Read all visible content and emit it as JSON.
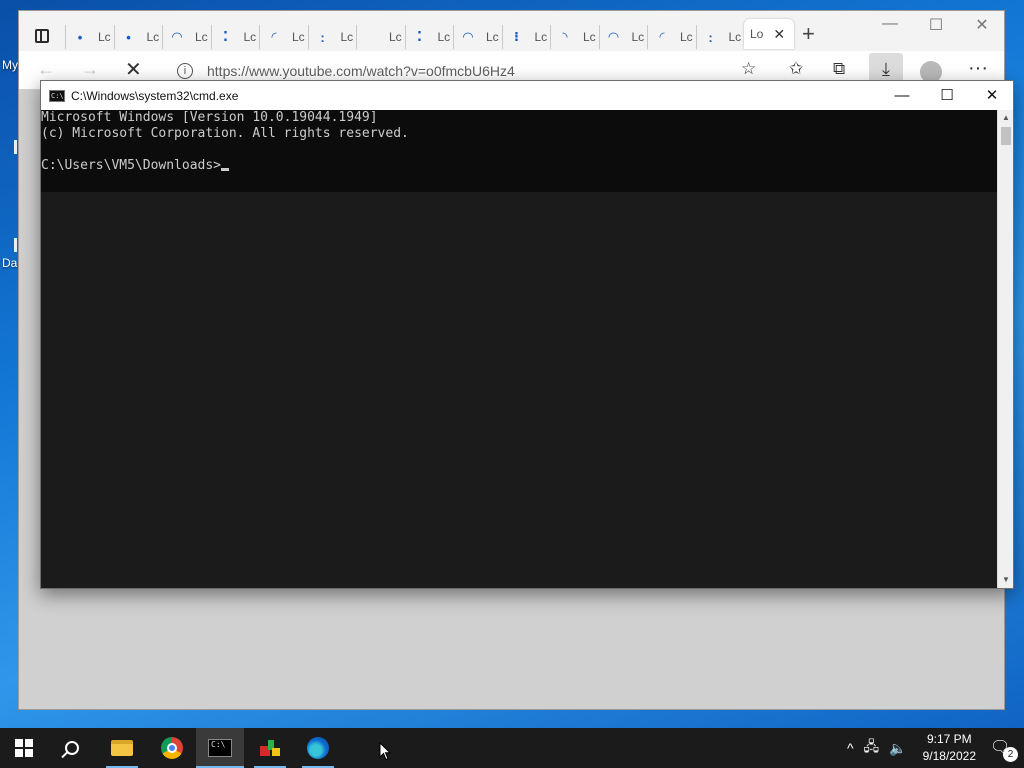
{
  "desktop": {
    "icon_labels": [
      "My",
      "Da"
    ]
  },
  "browser": {
    "tabs": [
      {
        "fav": "•",
        "label": "Lc"
      },
      {
        "fav": "•",
        "label": "Lc"
      },
      {
        "fav": "◠",
        "label": "Lc"
      },
      {
        "fav": "⁚",
        "label": "Lc"
      },
      {
        "fav": "◜",
        "label": "Lc"
      },
      {
        "fav": ":",
        "label": "Lc"
      },
      {
        "fav": "",
        "label": "Lc"
      },
      {
        "fav": "⁚",
        "label": "Lc"
      },
      {
        "fav": "◠",
        "label": "Lc"
      },
      {
        "fav": "⁝",
        "label": "Lc"
      },
      {
        "fav": "◝",
        "label": "Lc"
      },
      {
        "fav": "◠",
        "label": "Lc"
      },
      {
        "fav": "◜",
        "label": "Lc"
      },
      {
        "fav": ":",
        "label": "Lc"
      }
    ],
    "active_tab": {
      "label": "Lo",
      "close": "✕"
    },
    "new_tab": "+",
    "window_controls": {
      "minimize": "—",
      "maximize": "☐",
      "close": "✕"
    },
    "nav": {
      "back": "←",
      "forward": "→",
      "stop": "✕"
    },
    "url": "https://www.youtube.com/watch?v=o0fmcbU6Hz4",
    "info_icon": "i",
    "toolbar": {
      "add_favorite": "☆",
      "favorites": "✩",
      "collections": "⧉",
      "downloads": "⤓",
      "more": "···"
    }
  },
  "cmd": {
    "title": "C:\\Windows\\system32\\cmd.exe",
    "icon_text": "C:\\",
    "controls": {
      "minimize": "—",
      "maximize": "☐",
      "close": "✕"
    },
    "lines": [
      "Microsoft Windows [Version 10.0.19044.1949]",
      "(c) Microsoft Corporation. All rights reserved.",
      "",
      "C:\\Users\\VM5\\Downloads>"
    ],
    "scroll": {
      "up": "▲",
      "down": "▼"
    }
  },
  "taskbar": {
    "cmd_icon_text": "C:\\",
    "tray": {
      "chevron": "^",
      "network": "🖧",
      "volume": "🔈"
    },
    "time": "9:17 PM",
    "date": "9/18/2022",
    "notification_count": "2",
    "notification_icon": "🗨"
  }
}
